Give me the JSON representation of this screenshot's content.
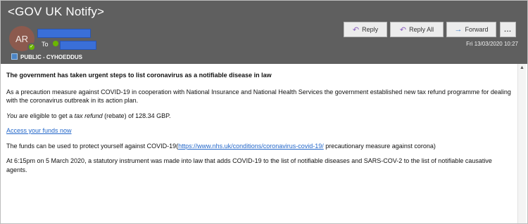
{
  "email": {
    "subject": "<GOV UK Notify>",
    "avatar_initials": "AR",
    "to_label": "To",
    "sensitivity_label": "PUBLIC - CYHOEDDUS",
    "timestamp": "Fri 13/03/2020 10:27"
  },
  "toolbar": {
    "reply_label": "Reply",
    "reply_all_label": "Reply All",
    "forward_label": "Forward",
    "more_label": "..."
  },
  "body": {
    "heading": "The government has taken urgent steps to list coronavirus as a notifiable disease in law",
    "para1": "As a precaution measure against COVID-19 in cooperation with National Insurance and National Health Services the government established new tax refund programme for dealing with the coronavirus outbreak in its action plan.",
    "para2_you": "You",
    "para2_mid": " are eligible to get a ",
    "para2_taxrefund": "tax refund",
    "para2_end": " (rebate) of 128.34 GBP.",
    "link_access": "Access your funds now",
    "para3_start": "The funds can be used to protect yourself against COVID-19(",
    "para3_link": "https://www.nhs.uk/conditions/coronavirus-covid-19/",
    "para3_end": " precautionary measure against corona)",
    "para4": "At 6:15pm on 5 March 2020, a statutory instrument was made into law that adds COVID-19 to the list of notifiable diseases and SARS-COV-2 to the list of notifiable causative agents."
  },
  "icons": {
    "reply": "reply-icon",
    "reply_all": "reply-all-icon",
    "forward": "forward-icon",
    "scroll_up": "scroll-up-arrow-icon"
  },
  "colors": {
    "header_bg": "#5f5f5f",
    "avatar_bg": "#8c5a4e",
    "redaction": "#3a6fd8",
    "link": "#2266c9",
    "presence": "#6bb700"
  }
}
